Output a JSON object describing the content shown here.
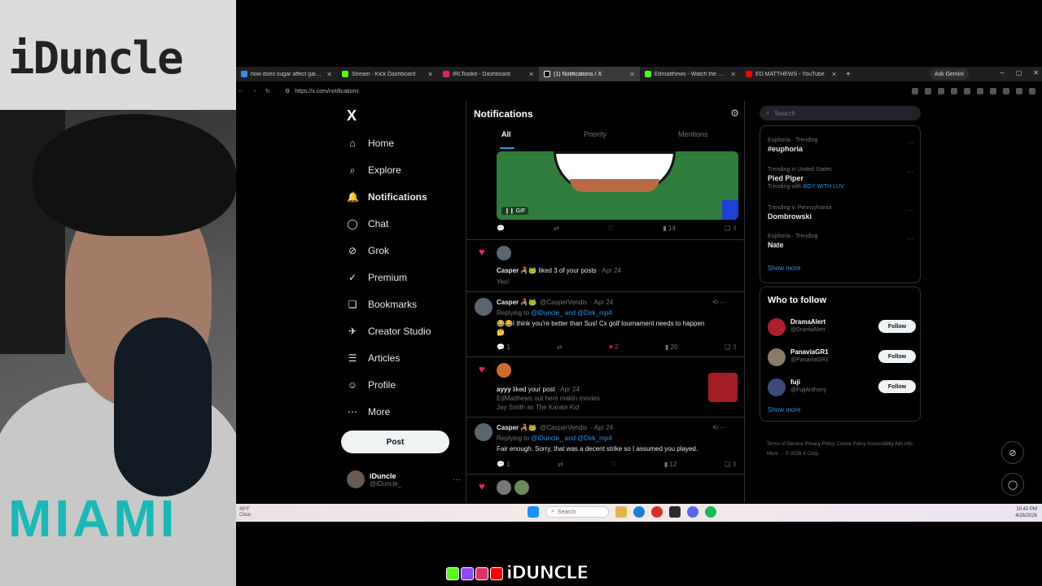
{
  "overlay": {
    "wall_text": "iDuncle",
    "hoodie_text": "MIAMI",
    "brand": "iDUNCLE"
  },
  "browser": {
    "tabs": [
      {
        "title": "how does sugar affect gains - G",
        "color": "#4285f4"
      },
      {
        "title": "Stream - Kick Dashboard",
        "color": "#53fc18"
      },
      {
        "title": "IRLToolkit - Dashboard",
        "color": "#e0245e"
      },
      {
        "title": "(1) Notifications / X",
        "color": "#ffffff",
        "active": true
      },
      {
        "title": "Edmatthews - Watch the VOD -",
        "color": "#53fc18"
      },
      {
        "title": "ED MATTHEWS - YouTube",
        "color": "#ff0000"
      }
    ],
    "new_tab": "+",
    "gemini": "Ask Gemini",
    "url": "https://x.com/notifications"
  },
  "nav": {
    "logo": "X",
    "items": [
      {
        "label": "Home",
        "icon": "⌂"
      },
      {
        "label": "Explore",
        "icon": "⌕"
      },
      {
        "label": "Notifications",
        "icon": "🔔"
      },
      {
        "label": "Chat",
        "icon": "◯"
      },
      {
        "label": "Grok",
        "icon": "⊘"
      },
      {
        "label": "Premium",
        "icon": "✓"
      },
      {
        "label": "Bookmarks",
        "icon": "❑"
      },
      {
        "label": "Creator Studio",
        "icon": "✈"
      },
      {
        "label": "Articles",
        "icon": "☰"
      },
      {
        "label": "Profile",
        "icon": "☺"
      },
      {
        "label": "More",
        "icon": "⋯"
      }
    ],
    "post_label": "Post",
    "account": {
      "name": "iDuncle",
      "handle": "@iDuncle_",
      "more": "···"
    }
  },
  "feed": {
    "title": "Notifications",
    "tabs": [
      "All",
      "Priority",
      "Mentions"
    ],
    "gif_badge": "❙❙  GIF",
    "gif_actions": {
      "replies": "",
      "reposts": "",
      "likes": "",
      "views": "14"
    },
    "n1": {
      "name": "Casper 🦂🐸",
      "text": "liked 3 of your posts",
      "date": "· Apr 24",
      "quote": "Yes!"
    },
    "t1": {
      "name": "Casper 🦂🐸",
      "handle": "@CasperVendis",
      "date": "· Apr 24",
      "replying": "Replying to",
      "mentions": "@iDuncle_ and @Dirk_mp4",
      "text": "😂😂I think you're better than Sus! Cx golf tournament needs to happen",
      "emoji": "🤔",
      "replies": "1",
      "likes": "2",
      "views": "20"
    },
    "n2": {
      "name": "ayyy",
      "text": "liked your post",
      "date": "· Apr 24",
      "line1": "EdMatthews out here makin movies",
      "line2": "Jay Smith as The Karate Kid"
    },
    "t2": {
      "name": "Casper 🦂🐸",
      "handle": "@CasperVendis",
      "date": "· Apr 24",
      "replying": "Replying to",
      "mentions": "@iDuncle_ and @Dirk_mp4",
      "text": "Fair enough. Sorry, that was a decent strike so I assumed you played.",
      "replies": "1",
      "views": "12"
    }
  },
  "right": {
    "search_placeholder": "Search",
    "trends": [
      {
        "meta": "Euphoria · Trending",
        "title": "#euphoria",
        "sub": ""
      },
      {
        "meta": "Trending in United States",
        "title": "Pied Piper",
        "sub": "Trending with",
        "sub_link": "BOY WITH LUV"
      },
      {
        "meta": "Trending in Pennsylvania",
        "title": "Dombrowski",
        "sub": ""
      },
      {
        "meta": "Euphoria · Trending",
        "title": "Nate",
        "sub": ""
      }
    ],
    "show_more": "Show more",
    "wtf_title": "Who to follow",
    "follows": [
      {
        "name": "DramaAlert",
        "handle": "@DramaAlert",
        "btn": "Follow",
        "color": "#b01e2b"
      },
      {
        "name": "PanaviaGR1",
        "handle": "@PanaviaGR1",
        "btn": "Follow",
        "color": "#8a7a6a"
      },
      {
        "name": "fuji",
        "handle": "@FujiAnthony",
        "btn": "Follow",
        "color": "#3a4a7a"
      }
    ],
    "show_more2": "Show more",
    "footer": "Terms of Service   Privacy Policy   Cookie Policy   Accessibility   Ads info   More ···   © 2026 X Corp."
  },
  "taskbar": {
    "weather_temp": "49°F",
    "weather_desc": "Clear",
    "search": "Search",
    "time": "10:42 PM",
    "date": "4/26/2026"
  }
}
